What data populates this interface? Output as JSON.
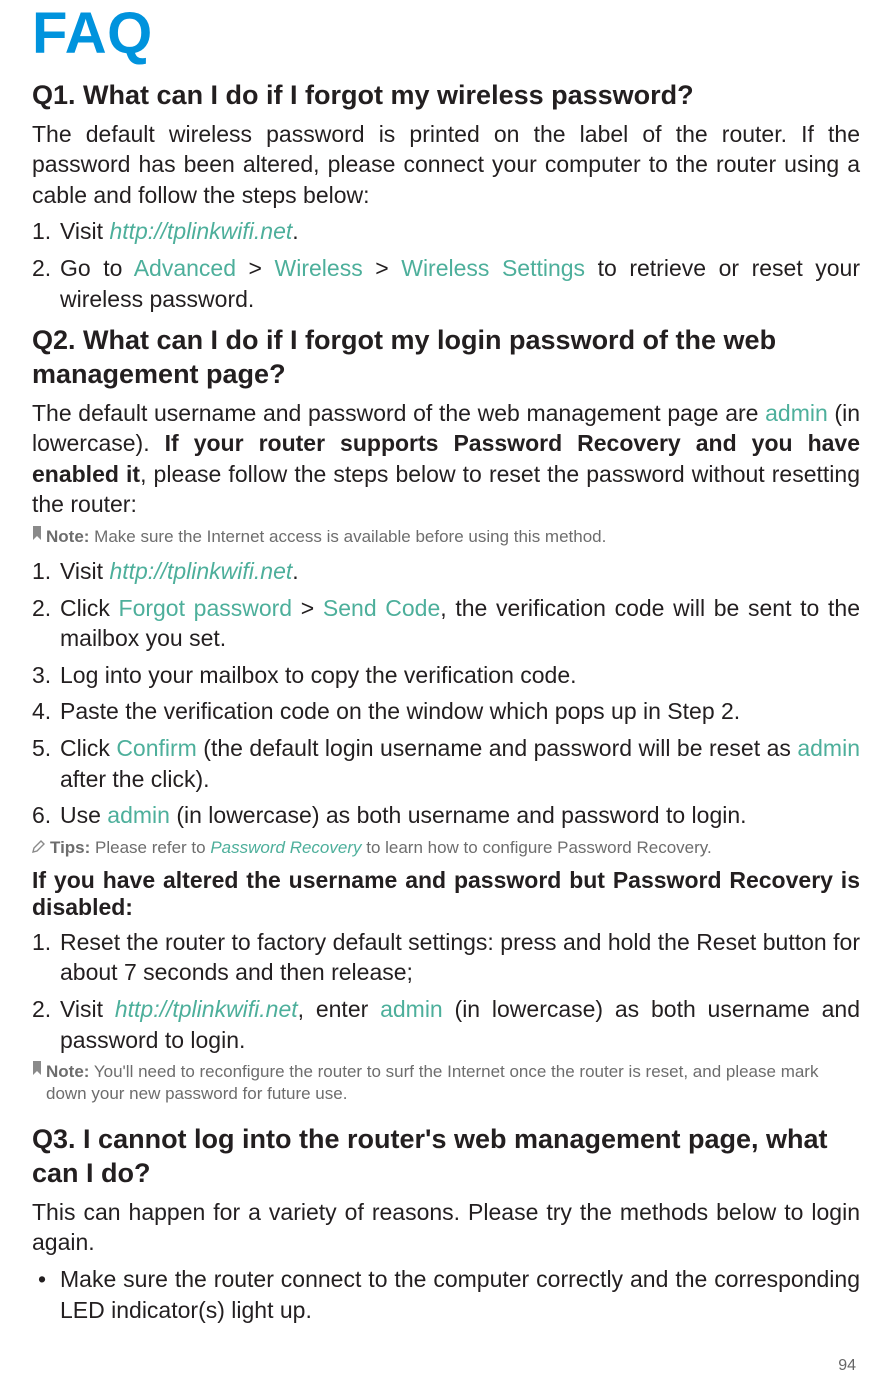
{
  "page_number": "94",
  "title": "FAQ",
  "q1": {
    "num": "Q1.",
    "heading": "What can I do if I forgot my wireless password?",
    "intro_1": "The default wireless password is printed on the label of the router. If the password has been altered, please connect your computer to the router using a cable and follow the steps below:",
    "steps": {
      "s1_num": "1. ",
      "s1_a": "Visit ",
      "s1_link": "http://tplinkwifi.net",
      "s1_b": ".",
      "s2_num": "2. ",
      "s2_a": "Go to ",
      "s2_l1": "Advanced",
      "s2_gt1": " > ",
      "s2_l2": "Wireless",
      "s2_gt2": " > ",
      "s2_l3": "Wireless Settings",
      "s2_b": " to retrieve or reset your wireless password."
    }
  },
  "q2": {
    "num": "Q2.",
    "heading": "What can I do if I forgot my login password of the web management page?",
    "intro_a": "The default username and password of the web management page are ",
    "intro_admin": "admin",
    "intro_b": " (in lowercase). ",
    "intro_bold": "If your router supports Password Recovery and you have enabled it",
    "intro_c": ", please follow the steps below to reset the password without resetting the router:",
    "note1_label": "Note:",
    "note1_body": " Make sure the Internet access is available before using this method.",
    "steps": {
      "s1_num": "1. ",
      "s1_a": "Visit ",
      "s1_link": "http://tplinkwifi.net",
      "s1_b": ".",
      "s2_num": "2. ",
      "s2_a": "Click ",
      "s2_l1": "Forgot password",
      "s2_gt1": " > ",
      "s2_l2": "Send Code",
      "s2_b": ", the verification code will be sent to the mailbox you set.",
      "s3_num": "3. ",
      "s3_a": "Log into your mailbox to copy the verification code.",
      "s4_num": "4. ",
      "s4_a": "Paste the verification code on the window which pops up in Step 2.",
      "s5_num": "5. ",
      "s5_a": "Click ",
      "s5_l1": "Confirm",
      "s5_b": " (the default login username and password will be reset as ",
      "s5_l2": "admin",
      "s5_c": " after the click).",
      "s6_num": "6. ",
      "s6_a": "Use ",
      "s6_l1": "admin",
      "s6_b": " (in lowercase) as both username and password to login."
    },
    "tips_label": "Tips:",
    "tips_a": " Please refer to ",
    "tips_link": "Password Recovery",
    "tips_b": " to learn how to configure Password Recovery.",
    "subhead": "If you have altered the username and password but Password Recovery is disabled:",
    "steps2": {
      "s1_num": "1. ",
      "s1_a": "Reset the router to factory default settings: press and hold the Reset button for about 7 seconds and then release;",
      "s2_num": "2. ",
      "s2_a": "Visit ",
      "s2_link": "http://tplinkwifi.net",
      "s2_b": ", enter ",
      "s2_l1": "admin",
      "s2_c": " (in lowercase) as both username and password to login."
    },
    "note2_label": "Note:",
    "note2_body": " You'll need to reconfigure the router to surf the Internet once the router is reset, and please mark down your new password for future use."
  },
  "q3": {
    "num": "Q3.",
    "heading": "I cannot log into the router's web management page, what can I do?",
    "intro": "This can happen for a variety of reasons. Please try the methods below to login again.",
    "bullets": {
      "b1": "Make sure the router connect to the computer correctly and the corresponding LED indicator(s) light up."
    }
  }
}
